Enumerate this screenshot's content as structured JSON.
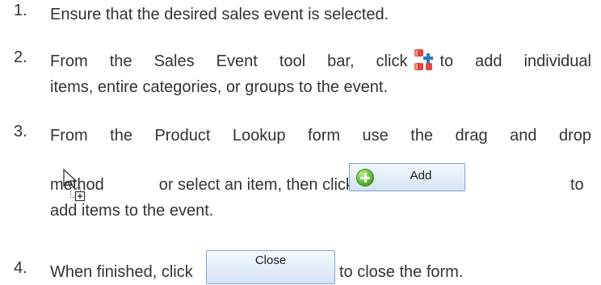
{
  "steps": [
    {
      "number": "1.",
      "text": "Ensure that the desired sales event is selected."
    },
    {
      "number": "2.",
      "text_before": "From the Sales Event tool bar, click",
      "text_after": "to add individual",
      "text_line2": "items, entire categories, or groups to the event."
    },
    {
      "number": "3.",
      "text_line1": "From the Product Lookup form use the drag and drop",
      "text_method": "method",
      "text_mid": "or select an item, then click",
      "text_end": "to",
      "text_line3": "add items to the event."
    },
    {
      "number": "4.",
      "text_before": "When finished, click",
      "text_after": "to close the form."
    }
  ],
  "buttons": {
    "add_label": "Add",
    "close_label": "Close"
  },
  "icons": {
    "tool": "add-items-tool-icon",
    "drag": "drag-drop-cursor-icon",
    "add": "plus-circle-icon"
  },
  "colors": {
    "text": "#333333",
    "button_border": "#7fa6cf",
    "icon_red": "#e0463e",
    "icon_blue": "#2a78c8",
    "icon_green": "#4fae2a"
  }
}
